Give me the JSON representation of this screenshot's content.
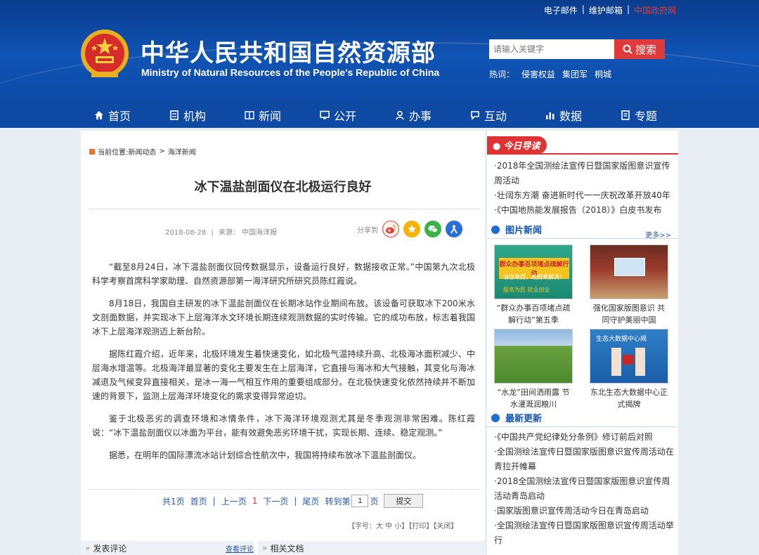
{
  "header": {
    "top_links": [
      "电子邮件",
      "|",
      "维护邮箱",
      "|",
      "中国政府网"
    ],
    "site_name_cn": "中华人民共和国自然资源部",
    "site_name_en": "Ministry of Natural Resources of the People's Republic of China",
    "search_placeholder": "请输入关键字",
    "search_button": "搜索",
    "hot_label": "热词：",
    "hot_words": [
      "侵害权益",
      "集团军",
      "桐城"
    ]
  },
  "nav": [
    "首页",
    "机构",
    "新闻",
    "公开",
    "办事",
    "互动",
    "数据",
    "专题"
  ],
  "article": {
    "breadcrumb_label": "当前位置:新闻动态",
    "breadcrumb_sep": ">",
    "breadcrumb_current": "海洋新闻",
    "title": "冰下温盐剖面仪在北极运行良好",
    "date": "2018-08-28",
    "source_sep": "|",
    "source": "来源：   中国海洋报",
    "share_label": "分享到",
    "paragraphs": [
      "“截至8月24日，冰下温盐剖面仪回传数据显示，设备运行良好，数据接收正常。”中国第九次北极科学考察首席科学家助理、自然资源部第一海洋研究所研究员陈红霞说。",
      "8月18日，我国自主研发的冰下温盐剖面仪在长期冰站作业期间布放。该设备可获取冰下200米水文剖面数据，并实现冰下上层海洋水文环境长期连续观测数据的实时传输。它的成功布放，标志着我国冰下上层海洋观测迈上新台阶。",
      "据陈红霞介绍，近年来，北极环境发生着快速变化，如北极气温持续升高、北极海冰面积减少、中层海水增温等。北极海洋最显著的变化主要发生在上层海洋，它直接与海冰和大气接触，其变化与海冰减退及气候变异直接相关，是冰一海一气相互作用的重要组成部分。在北极快速变化依然持续并不断加速的背景下，监测上层海洋环境变化的需求变得异常迫切。",
      "鉴于北极恶劣的调查环境和冰情条件，冰下海洋环境观测尤其是冬季观测非常困难。陈红霞说：“冰下温盐剖面仪以冰面为平台，能有效避免恶劣环境干扰，实现长期、连续、稳定观测。”",
      "据悉，在明年的国际漂流冰站计划综合性航次中，我国将持续布放冰下温盐剖面仪。"
    ],
    "pager": {
      "total": "共1页",
      "first": "首页",
      "sep": "|",
      "prev": "上一页",
      "current": "1",
      "next": "下一页",
      "last": "尾页",
      "goto": "转到第",
      "page_value": "1",
      "page_unit": "页",
      "submit": "提交"
    },
    "tools": "【字号：大  中  小】【打印】【关闭】",
    "comment": "发表评论",
    "view_comments": "查看评论",
    "related_docs": "相关文档"
  },
  "sidebar": {
    "today_title": "今日导读",
    "today_items": [
      "·2018年全国测绘法宣传日暨国家版图意识宣传周活动",
      "·壮阔东方潮  奋进新时代一一庆祝改革开放40年",
      "·《中国地热能发展报告（2018）》白皮书发布"
    ],
    "photos_title": "图片新闻",
    "more": "更多>>",
    "photos": [
      {
        "caption": "“群众办事百项堵点疏解行动”第五季",
        "banner": "群众办事百项堵点疏解行动",
        "sub1": "请您来提，政府来解决！",
        "sub2": "服务为民  就业创业"
      },
      {
        "caption": "强化国家版图意识  共同守护美丽中国"
      },
      {
        "caption": "“水龙”田间洒雨露  节水灌溉润粮川"
      },
      {
        "caption": "东北生态大数据中心正式揭牌",
        "banner": "生态大数据中心揭"
      }
    ],
    "latest_title": "最新更新",
    "latest_items": [
      "·《中国共产党纪律处分条例》修订前后对照",
      "·全国测绘法宣传日暨国家版图意识宣传周活动在青拉开帷幕",
      "·2018全国测绘法宣传日暨国家版图意识宣传周活动青岛启动",
      "·国家版图意识宣传周活动今日在青岛启动",
      "·全国测绘法宣传日暨国家版图意识宣传周活动举行"
    ]
  },
  "colors": {
    "header_blue": "#1054b4",
    "nav_blue": "#0e4aa3",
    "search_red": "#e03a3a",
    "accent_red": "#d33",
    "link_blue": "#2a5aa6"
  }
}
